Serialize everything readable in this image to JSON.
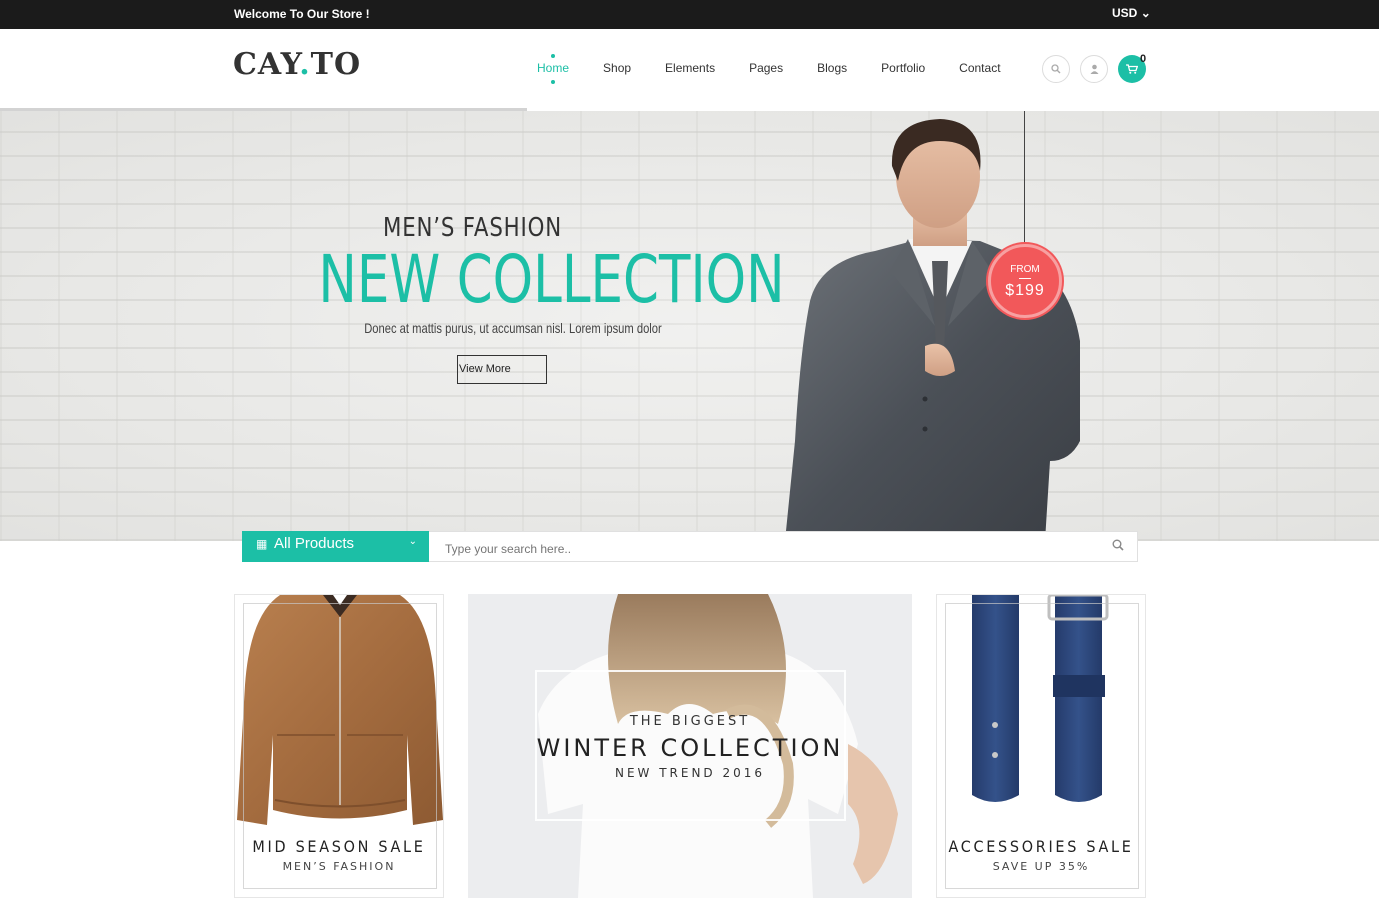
{
  "topbar": {
    "welcome": "Welcome To Our Store !",
    "currency": "USD",
    "currency_caret": "⌄"
  },
  "header": {
    "logo_main": "CAY",
    "logo_dot": ".",
    "logo_tail": "TO",
    "nav": [
      {
        "label": "Home",
        "active": true
      },
      {
        "label": "Shop"
      },
      {
        "label": "Elements"
      },
      {
        "label": "Pages"
      },
      {
        "label": "Blogs"
      },
      {
        "label": "Portfolio"
      },
      {
        "label": "Contact"
      }
    ],
    "cart_count": "0",
    "icons": {
      "search": "search-icon",
      "user": "user-icon",
      "cart": "cart-icon"
    }
  },
  "hero": {
    "subtitle": "MEN’S FASHION",
    "title": "NEW COLLECTION",
    "description": "Donec at mattis purus, ut accumsan nisl. Lorem ipsum dolor",
    "button": "View More",
    "tag_from": "FROM",
    "tag_price": "$199"
  },
  "search": {
    "category": "All Products",
    "placeholder": "Type your search here..",
    "grid_glyph": "▦",
    "chevron_glyph": "⌄",
    "search_glyph": "⚲"
  },
  "banners": {
    "left": {
      "title": "MID SEASON SALE",
      "subtitle": "MEN’S FASHION"
    },
    "center": {
      "eyebrow": "THE BIGGEST",
      "title": "WINTER COLLECTION",
      "subtitle": "NEW TREND 2016"
    },
    "right": {
      "title": "ACCESSORIES SALE",
      "subtitle": "SAVE UP 35%"
    }
  },
  "colors": {
    "accent": "#1cbfa6",
    "price_tag": "#f2585a",
    "topbar": "#1b1b1b"
  }
}
